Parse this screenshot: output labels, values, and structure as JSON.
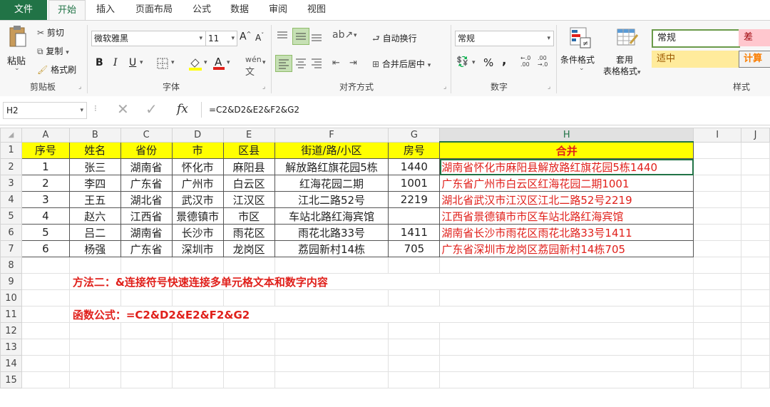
{
  "tabs": [
    "文件",
    "开始",
    "插入",
    "页面布局",
    "公式",
    "数据",
    "审阅",
    "视图"
  ],
  "clipboard": {
    "paste": "粘贴",
    "cut": "剪切",
    "copy": "复制",
    "format_painter": "格式刷",
    "label": "剪贴板"
  },
  "font": {
    "name": "微软雅黑",
    "size": "11",
    "bold": "B",
    "italic": "I",
    "underline": "U",
    "label": "字体"
  },
  "alignment": {
    "wrap": "自动换行",
    "merge": "合并后居中",
    "label": "对齐方式"
  },
  "number": {
    "format": "常规",
    "percent": "%",
    "comma": ",",
    "label": "数字"
  },
  "styles": {
    "conditional": "条件格式",
    "table_format_1": "套用",
    "table_format_2": "表格格式",
    "normal": "常规",
    "bad": "差",
    "neutral": "适中",
    "calc": "计算",
    "label": "样式"
  },
  "formula_bar": {
    "name_box": "H2",
    "fx": "fx",
    "formula": "=C2&D2&E2&F2&G2"
  },
  "columns": [
    "A",
    "B",
    "C",
    "D",
    "E",
    "F",
    "G",
    "H",
    "I",
    "J"
  ],
  "rows": [
    "1",
    "2",
    "3",
    "4",
    "5",
    "6",
    "7",
    "8",
    "9",
    "10",
    "11",
    "12",
    "13",
    "14",
    "15"
  ],
  "table": {
    "headers": [
      "序号",
      "姓名",
      "省份",
      "市",
      "区县",
      "街道/路/小区",
      "房号",
      "合并"
    ],
    "data": [
      [
        "1",
        "张三",
        "湖南省",
        "怀化市",
        "麻阳县",
        "解放路红旗花园5栋",
        "1440",
        "湖南省怀化市麻阳县解放路红旗花园5栋1440"
      ],
      [
        "2",
        "李四",
        "广东省",
        "广州市",
        "白云区",
        "红海花园二期",
        "1001",
        "广东省广州市白云区红海花园二期1001"
      ],
      [
        "3",
        "王五",
        "湖北省",
        "武汉市",
        "江汉区",
        "江北二路52号",
        "2219",
        "湖北省武汉市江汉区江北二路52号2219"
      ],
      [
        "4",
        "赵六",
        "江西省",
        "景德镇市",
        "市区",
        "车站北路红海宾馆",
        "",
        "江西省景德镇市市区车站北路红海宾馆"
      ],
      [
        "5",
        "吕二",
        "湖南省",
        "长沙市",
        "雨花区",
        "雨花北路33号",
        "1411",
        "湖南省长沙市雨花区雨花北路33号1411"
      ],
      [
        "6",
        "杨强",
        "广东省",
        "深圳市",
        "龙岗区",
        "荔园新村14栋",
        "705",
        "广东省深圳市龙岗区荔园新村14栋705"
      ]
    ]
  },
  "notes": {
    "method": "方法二：&连接符号快速连接多单元格文本和数字内容",
    "formula": "函数公式：=C2&D2&E2&F2&G2"
  },
  "colors": {
    "accent": "#217346",
    "header_fill": "#ffff00",
    "red_text": "#e0201b",
    "bad_fill": "#ffc7ce",
    "neutral_fill": "#ffeb9c",
    "calc_fill": "#f2f2f2"
  }
}
